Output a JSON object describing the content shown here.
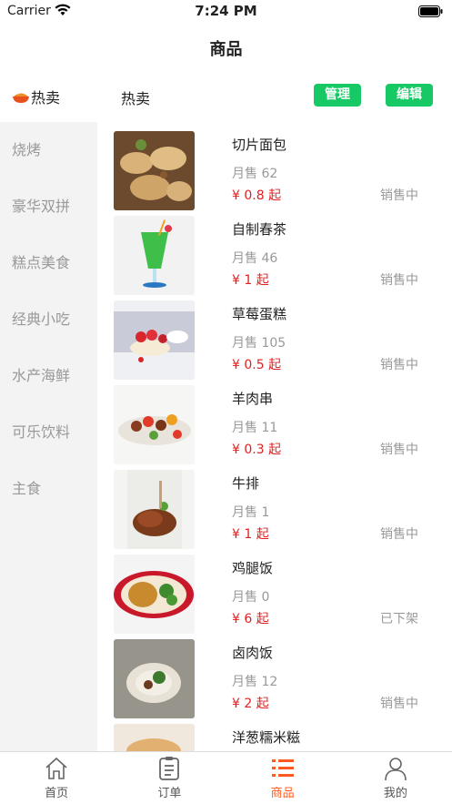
{
  "status_bar": {
    "carrier": "Carrier",
    "time": "7:24 PM"
  },
  "nav": {
    "title": "商品"
  },
  "top_bar": {
    "hot_label": "热卖",
    "current_category": "热卖",
    "manage_label": "管理",
    "edit_label": "编辑"
  },
  "sidebar": {
    "items": [
      "烧烤",
      "豪华双拼",
      "糕点美食",
      "经典小吃",
      "水产海鲜",
      "可乐饮料",
      "主食"
    ]
  },
  "products": [
    {
      "name": "切片面包",
      "sales": "月售 62",
      "price": "¥ 0.8 起",
      "status": "销售中",
      "image": "bread"
    },
    {
      "name": "自制春茶",
      "sales": "月售 46",
      "price": "¥ 1 起",
      "status": "销售中",
      "image": "drink"
    },
    {
      "name": "草莓蛋糕",
      "sales": "月售 105",
      "price": "¥ 0.5 起",
      "status": "销售中",
      "image": "cake"
    },
    {
      "name": "羊肉串",
      "sales": "月售 11",
      "price": "¥ 0.3 起",
      "status": "销售中",
      "image": "skewer"
    },
    {
      "name": "牛排",
      "sales": "月售 1",
      "price": "¥ 1 起",
      "status": "销售中",
      "image": "steak"
    },
    {
      "name": "鸡腿饭",
      "sales": "月售 0",
      "price": "¥ 6 起",
      "status": "已下架",
      "image": "chicken"
    },
    {
      "name": "卤肉饭",
      "sales": "月售 12",
      "price": "¥ 2 起",
      "status": "销售中",
      "image": "rice"
    },
    {
      "name": "洋葱糯米糍",
      "sales": "",
      "price": "",
      "status": "",
      "image": "mochi"
    }
  ],
  "tab_bar": {
    "tabs": [
      {
        "label": "首页",
        "icon": "home-icon",
        "active": false
      },
      {
        "label": "订单",
        "icon": "order-icon",
        "active": false
      },
      {
        "label": "商品",
        "icon": "list-icon",
        "active": true
      },
      {
        "label": "我的",
        "icon": "user-icon",
        "active": false
      }
    ]
  },
  "colors": {
    "accent_green": "#17c964",
    "price_red": "#e02020",
    "active_orange": "#ff5a1f"
  }
}
